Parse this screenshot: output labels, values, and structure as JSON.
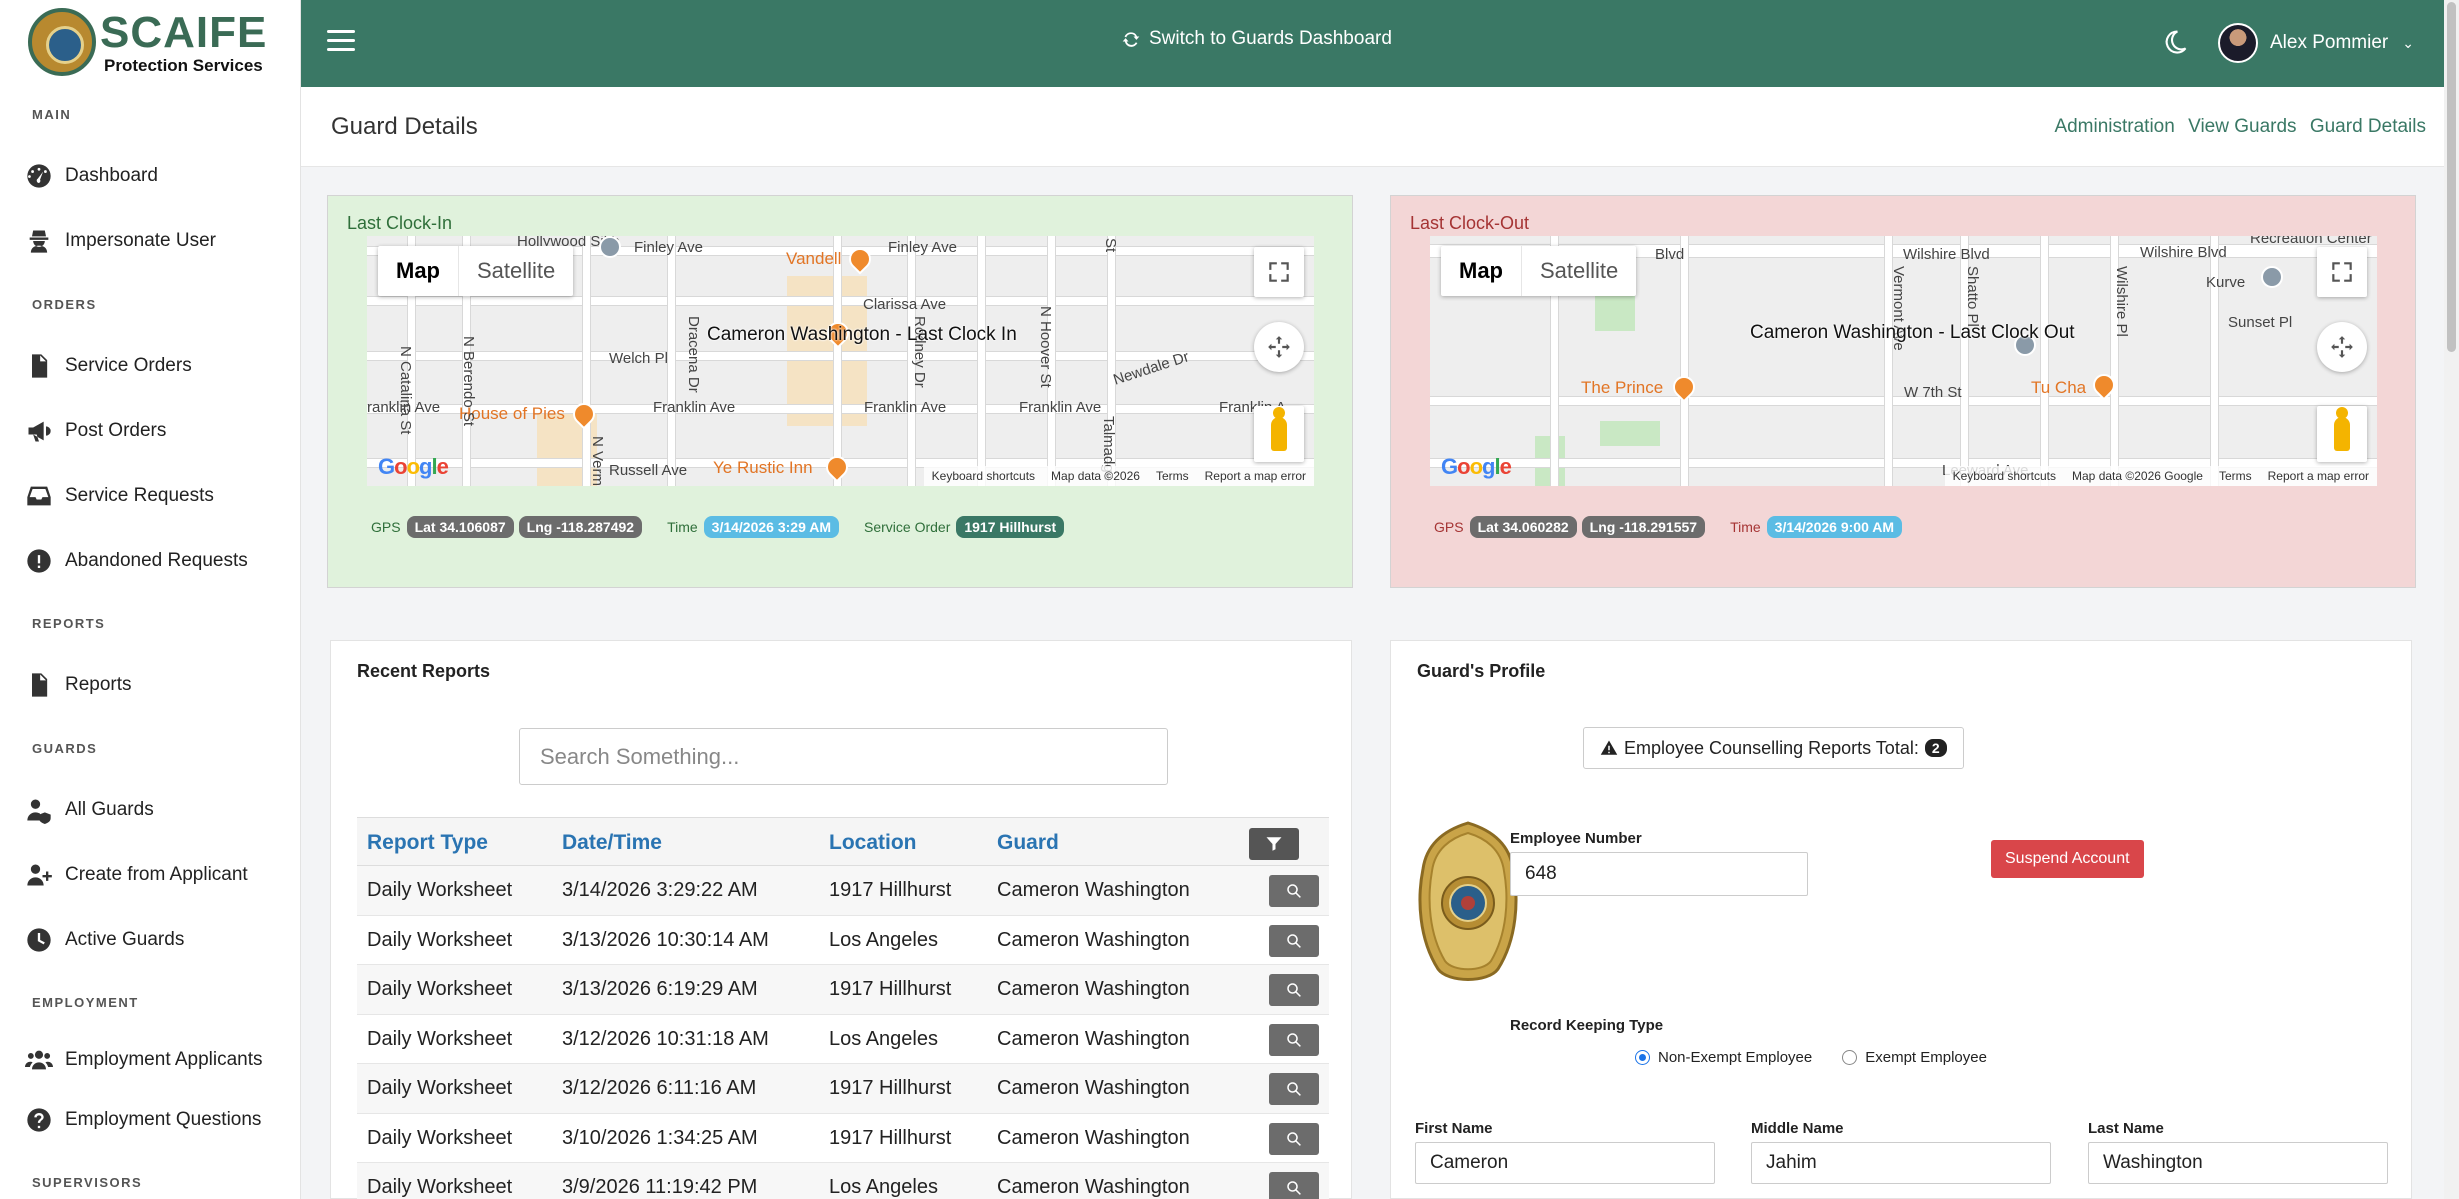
{
  "brand": {
    "name": "SCAIFE",
    "subtitle": "Protection Services",
    "color": "#3a7865"
  },
  "sidebar": {
    "sections": [
      "MAIN",
      "ORDERS",
      "REPORTS",
      "GUARDS",
      "EMPLOYMENT",
      "SUPERVISORS"
    ],
    "items": [
      {
        "label": "Dashboard",
        "icon": "dashboard-icon"
      },
      {
        "label": "Impersonate User",
        "icon": "user-secret-icon"
      },
      {
        "label": "Service Orders",
        "icon": "file-icon"
      },
      {
        "label": "Post Orders",
        "icon": "megaphone-icon"
      },
      {
        "label": "Service Requests",
        "icon": "inbox-icon"
      },
      {
        "label": "Abandoned Requests",
        "icon": "alert-circle-icon"
      },
      {
        "label": "Reports",
        "icon": "file-text-icon"
      },
      {
        "label": "All Guards",
        "icon": "user-shield-icon"
      },
      {
        "label": "Create from Applicant",
        "icon": "user-plus-icon"
      },
      {
        "label": "Active Guards",
        "icon": "clock-icon"
      },
      {
        "label": "Employment Applicants",
        "icon": "users-icon"
      },
      {
        "label": "Employment Questions",
        "icon": "question-circle-icon"
      }
    ]
  },
  "topbar": {
    "switch_label": "Switch to Guards Dashboard",
    "user_name": "Alex Pommier"
  },
  "header": {
    "title": "Guard Details",
    "breadcrumbs": [
      "Administration",
      "View Guards",
      "Guard Details"
    ]
  },
  "clock_in": {
    "label": "Last Clock-In",
    "marker_label": "Cameron Washington - Last Clock In",
    "gps_label": "GPS",
    "lat": "Lat 34.106087",
    "lng": "Lng -118.287492",
    "time_label": "Time",
    "time": "3/14/2026 3:29 AM",
    "service_order_label": "Service Order",
    "service_order": "1917 Hillhurst",
    "streets": {
      "s1": "Hollywood Sikh",
      "s2": "Finley Ave",
      "s3": "Vandell",
      "s4": "Finley Ave",
      "s5": "Clarissa Ave",
      "s6": "Welch Pl",
      "s7": "Franklin Ave",
      "s8": "Franklin Ave",
      "s9": "Franklin Ave",
      "s10": "Franklin A",
      "s11": "House of Pies",
      "s12": "ranklin Ave",
      "s13": "Russell Ave",
      "s14": "Ye Rustic Inn",
      "s15": "Newdale Dr",
      "v1": "N Catalina St",
      "v2": "N Berendo St",
      "v3": "Dracena Dr",
      "v4": "Rodney Dr",
      "v5": "N Vermont",
      "v6": "N Hoover St",
      "v7": "Talmadge",
      "v8": "St"
    }
  },
  "clock_out": {
    "label": "Last Clock-Out",
    "marker_label": "Cameron Washington - Last Clock Out",
    "gps_label": "GPS",
    "lat": "Lat 34.060282",
    "lng": "Lng -118.291557",
    "time_label": "Time",
    "time": "3/14/2026 9:00 AM",
    "streets": {
      "s1": "Blvd",
      "s2": "Wilshire Blvd",
      "s3": "Wilshire Blvd",
      "s4": "The Prince",
      "s5": "Tu Cha",
      "s6": "W 7th St",
      "s7": "Kurve",
      "s8": "Sunset Pl",
      "s9": "Leeward Ave",
      "s10": "Recreation Center",
      "v1": "Vermont Ave",
      "v2": "Shatto Pl",
      "v3": "Wilshire Pl"
    }
  },
  "map_common": {
    "type_map": "Map",
    "type_satellite": "Satellite",
    "keyboard": "Keyboard shortcuts",
    "terms": "Terms",
    "report": "Report a map error",
    "data_in": "Map data ©2026",
    "data_out": "Map data ©2026 Google"
  },
  "reports": {
    "title": "Recent Reports",
    "search_placeholder": "Search Something...",
    "columns": [
      "Report Type",
      "Date/Time",
      "Location",
      "Guard"
    ],
    "rows": [
      [
        "Daily Worksheet",
        "3/14/2026 3:29:22 AM",
        "1917 Hillhurst",
        "Cameron Washington"
      ],
      [
        "Daily Worksheet",
        "3/13/2026 10:30:14 AM",
        "Los Angeles",
        "Cameron Washington"
      ],
      [
        "Daily Worksheet",
        "3/13/2026 6:19:29 AM",
        "1917 Hillhurst",
        "Cameron Washington"
      ],
      [
        "Daily Worksheet",
        "3/12/2026 10:31:18 AM",
        "Los Angeles",
        "Cameron Washington"
      ],
      [
        "Daily Worksheet",
        "3/12/2026 6:11:16 AM",
        "1917 Hillhurst",
        "Cameron Washington"
      ],
      [
        "Daily Worksheet",
        "3/10/2026 1:34:25 AM",
        "1917 Hillhurst",
        "Cameron Washington"
      ],
      [
        "Daily Worksheet",
        "3/9/2026 11:19:42 PM",
        "Los Angeles",
        "Cameron Washington"
      ]
    ]
  },
  "profile": {
    "title": "Guard's Profile",
    "counselling_label": "Employee Counselling Reports Total:",
    "counselling_count": "2",
    "employee_number_label": "Employee Number",
    "employee_number": "648",
    "suspend_label": "Suspend Account",
    "record_keeping_label": "Record Keeping Type",
    "non_exempt": "Non-Exempt Employee",
    "exempt": "Exempt Employee",
    "first_name_label": "First Name",
    "first_name": "Cameron",
    "middle_name_label": "Middle Name",
    "middle_name": "Jahim",
    "last_name_label": "Last Name",
    "last_name": "Washington"
  }
}
